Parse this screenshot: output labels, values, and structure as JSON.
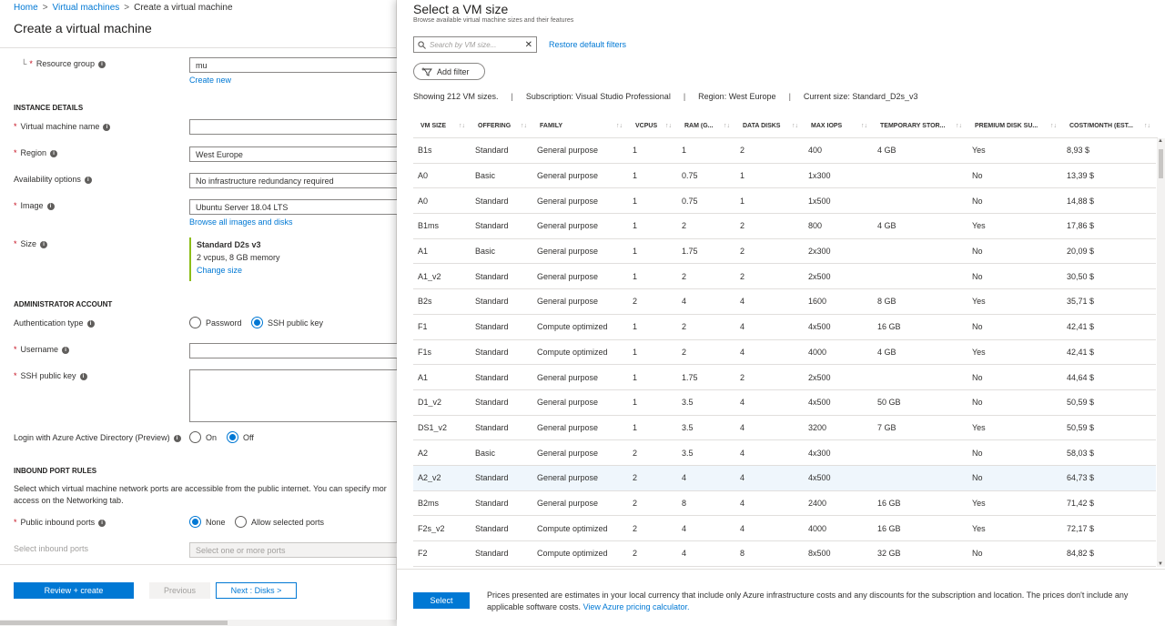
{
  "breadcrumb": {
    "home": "Home",
    "vms": "Virtual machines",
    "current": "Create a virtual machine"
  },
  "left": {
    "title": "Create a virtual machine",
    "resource_group": {
      "label": "Resource group",
      "value": "mu",
      "create_new": "Create new"
    },
    "instance_details": "INSTANCE DETAILS",
    "vm_name": {
      "label": "Virtual machine name",
      "value": ""
    },
    "region": {
      "label": "Region",
      "value": "West Europe"
    },
    "availability": {
      "label": "Availability options",
      "value": "No infrastructure redundancy required"
    },
    "image": {
      "label": "Image",
      "value": "Ubuntu Server 18.04 LTS",
      "browse": "Browse all images and disks"
    },
    "size": {
      "label": "Size",
      "name": "Standard D2s v3",
      "detail": "2 vcpus, 8 GB memory",
      "change": "Change size"
    },
    "admin_account": "ADMINISTRATOR ACCOUNT",
    "auth_type": {
      "label": "Authentication type",
      "opt_password": "Password",
      "opt_ssh": "SSH public key"
    },
    "username": {
      "label": "Username",
      "value": ""
    },
    "ssh_key": {
      "label": "SSH public key",
      "value": ""
    },
    "aad_login": {
      "label": "Login with Azure Active Directory (Preview)",
      "opt_on": "On",
      "opt_off": "Off"
    },
    "inbound_rules": "INBOUND PORT RULES",
    "inbound_desc_1": "Select which virtual machine network ports are accessible from the public internet. You can specify mor",
    "inbound_desc_2": "access on the Networking tab.",
    "public_ports": {
      "label": "Public inbound ports",
      "opt_none": "None",
      "opt_allow": "Allow selected ports"
    },
    "select_ports": {
      "label": "Select inbound ports",
      "placeholder": "Select one or more ports"
    },
    "buttons": {
      "review": "Review + create",
      "previous": "Previous",
      "next": "Next : Disks >"
    }
  },
  "right": {
    "title": "Select a VM size",
    "subtitle": "Browse available virtual machine sizes and their features",
    "search_placeholder": "Search by VM size...",
    "restore": "Restore default filters",
    "add_filter": "Add filter",
    "summary": {
      "count": "Showing 212 VM sizes.",
      "subscription": "Subscription: Visual Studio Professional",
      "region": "Region: West Europe",
      "current": "Current size: Standard_D2s_v3"
    },
    "columns": [
      "VM SIZE",
      "OFFERING",
      "FAMILY",
      "VCPUS",
      "RAM (G...",
      "DATA DISKS",
      "MAX IOPS",
      "TEMPORARY STOR...",
      "PREMIUM DISK SU...",
      "COST/MONTH (EST..."
    ],
    "rows": [
      [
        "B1s",
        "Standard",
        "General purpose",
        "1",
        "1",
        "2",
        "400",
        "4 GB",
        "Yes",
        "8,93 $"
      ],
      [
        "A0",
        "Basic",
        "General purpose",
        "1",
        "0.75",
        "1",
        "1x300",
        "",
        "No",
        "13,39 $"
      ],
      [
        "A0",
        "Standard",
        "General purpose",
        "1",
        "0.75",
        "1",
        "1x500",
        "",
        "No",
        "14,88 $"
      ],
      [
        "B1ms",
        "Standard",
        "General purpose",
        "1",
        "2",
        "2",
        "800",
        "4 GB",
        "Yes",
        "17,86 $"
      ],
      [
        "A1",
        "Basic",
        "General purpose",
        "1",
        "1.75",
        "2",
        "2x300",
        "",
        "No",
        "20,09 $"
      ],
      [
        "A1_v2",
        "Standard",
        "General purpose",
        "1",
        "2",
        "2",
        "2x500",
        "",
        "No",
        "30,50 $"
      ],
      [
        "B2s",
        "Standard",
        "General purpose",
        "2",
        "4",
        "4",
        "1600",
        "8 GB",
        "Yes",
        "35,71 $"
      ],
      [
        "F1",
        "Standard",
        "Compute optimized",
        "1",
        "2",
        "4",
        "4x500",
        "16 GB",
        "No",
        "42,41 $"
      ],
      [
        "F1s",
        "Standard",
        "Compute optimized",
        "1",
        "2",
        "4",
        "4000",
        "4 GB",
        "Yes",
        "42,41 $"
      ],
      [
        "A1",
        "Standard",
        "General purpose",
        "1",
        "1.75",
        "2",
        "2x500",
        "",
        "No",
        "44,64 $"
      ],
      [
        "D1_v2",
        "Standard",
        "General purpose",
        "1",
        "3.5",
        "4",
        "4x500",
        "50 GB",
        "No",
        "50,59 $"
      ],
      [
        "DS1_v2",
        "Standard",
        "General purpose",
        "1",
        "3.5",
        "4",
        "3200",
        "7 GB",
        "Yes",
        "50,59 $"
      ],
      [
        "A2",
        "Basic",
        "General purpose",
        "2",
        "3.5",
        "4",
        "4x300",
        "",
        "No",
        "58,03 $"
      ],
      [
        "A2_v2",
        "Standard",
        "General purpose",
        "2",
        "4",
        "4",
        "4x500",
        "",
        "No",
        "64,73 $"
      ],
      [
        "B2ms",
        "Standard",
        "General purpose",
        "2",
        "8",
        "4",
        "2400",
        "16 GB",
        "Yes",
        "71,42 $"
      ],
      [
        "F2s_v2",
        "Standard",
        "Compute optimized",
        "2",
        "4",
        "4",
        "4000",
        "16 GB",
        "Yes",
        "72,17 $"
      ],
      [
        "F2",
        "Standard",
        "Compute optimized",
        "2",
        "4",
        "8",
        "8x500",
        "32 GB",
        "No",
        "84,82 $"
      ]
    ],
    "selected_row": "A2_v2",
    "select_button": "Select",
    "footnote": "Prices presented are estimates in your local currency that include only Azure infrastructure costs and any discounts for the subscription and location. The prices don't include any applicable software costs.",
    "pricing_link": "View Azure pricing calculator."
  },
  "colors": {
    "accent": "#0078d4",
    "required": "#c50f1f",
    "selected_row": "#eff6fc",
    "size_bar": "#8cbd18"
  }
}
